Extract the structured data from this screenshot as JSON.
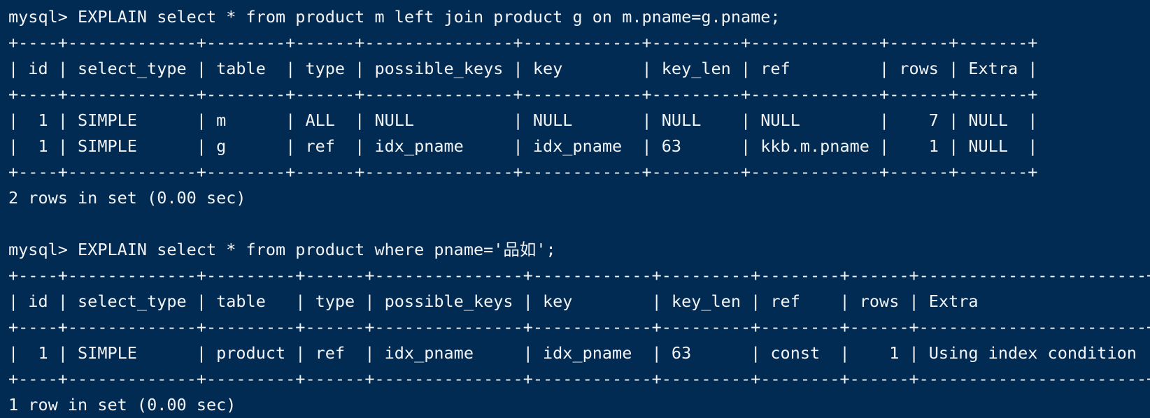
{
  "terminal": {
    "background_color": "#012b52",
    "text_color": "#f2f4f7",
    "prompt": "mysql>"
  },
  "blocks": [
    {
      "name": "explain-left-join",
      "command": "mysql> EXPLAIN select * from product m left join product g on m.pname=g.pname;",
      "table": {
        "columns": [
          "id",
          "select_type",
          "table",
          "type",
          "possible_keys",
          "key",
          "key_len",
          "ref",
          "rows",
          "Extra"
        ],
        "widths": [
          4,
          13,
          8,
          6,
          15,
          12,
          9,
          13,
          6,
          7
        ],
        "align": [
          "right",
          "left",
          "left",
          "left",
          "left",
          "left",
          "left",
          "left",
          "right",
          "left"
        ],
        "rows": [
          [
            "1",
            "SIMPLE",
            "m",
            "ALL",
            "NULL",
            "NULL",
            "NULL",
            "NULL",
            "7",
            "NULL"
          ],
          [
            "1",
            "SIMPLE",
            "g",
            "ref",
            "idx_pname",
            "idx_pname",
            "63",
            "kkb.m.pname",
            "1",
            "NULL"
          ]
        ]
      },
      "status": "2 rows in set (0.00 sec)"
    },
    {
      "name": "explain-where-pname",
      "command": "mysql> EXPLAIN select * from product where pname='品如';",
      "table": {
        "columns": [
          "id",
          "select_type",
          "table",
          "type",
          "possible_keys",
          "key",
          "key_len",
          "ref",
          "rows",
          "Extra"
        ],
        "widths": [
          4,
          13,
          9,
          6,
          15,
          12,
          9,
          8,
          6,
          23
        ],
        "align": [
          "right",
          "left",
          "left",
          "left",
          "left",
          "left",
          "left",
          "left",
          "right",
          "left"
        ],
        "rows": [
          [
            "1",
            "SIMPLE",
            "product",
            "ref",
            "idx_pname",
            "idx_pname",
            "63",
            "const",
            "1",
            "Using index condition"
          ]
        ]
      },
      "status": "1 row in set (0.00 sec)"
    }
  ]
}
